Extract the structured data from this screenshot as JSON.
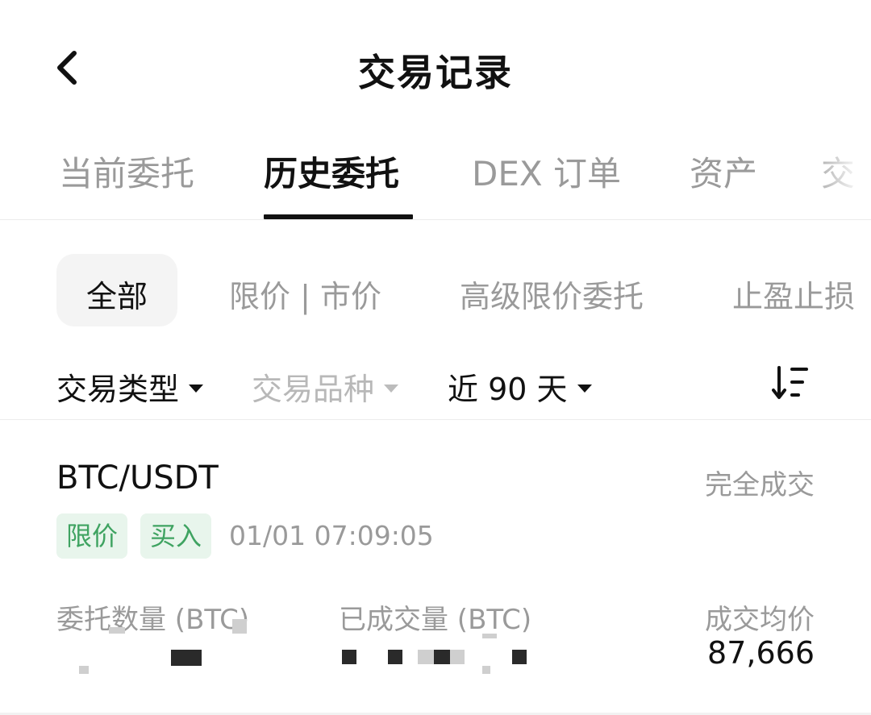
{
  "header": {
    "title": "交易记录",
    "back_icon": "chevron-left-icon"
  },
  "tabs": [
    {
      "label": "当前委托",
      "active": false
    },
    {
      "label": "历史委托",
      "active": true
    },
    {
      "label": "DEX 订单",
      "active": false
    },
    {
      "label": "资产",
      "active": false
    },
    {
      "label": "交",
      "active": false
    }
  ],
  "chips": [
    {
      "label": "全部",
      "active": true
    },
    {
      "label": "限价 | 市价",
      "active": false
    },
    {
      "label": "高级限价委托",
      "active": false
    },
    {
      "label": "止盈止损",
      "active": false
    }
  ],
  "filters": {
    "trade_type": "交易类型",
    "trade_symbol": "交易品种",
    "period": "近 90 天",
    "sort_icon": "sort-descending-icon"
  },
  "order": {
    "pair": "BTC/USDT",
    "status": "完全成交",
    "tags": [
      "限价",
      "买入"
    ],
    "time": "01/01 07:09:05",
    "columns": {
      "qty_label": "委托数量 (BTC)",
      "filled_label": "已成交量 (BTC)",
      "avg_label": "成交均价",
      "avg_value": "87,666"
    }
  },
  "colors": {
    "accent_green": "#3fa361",
    "tag_bg": "#e8f5ec",
    "muted_text": "#9a9a9a"
  }
}
